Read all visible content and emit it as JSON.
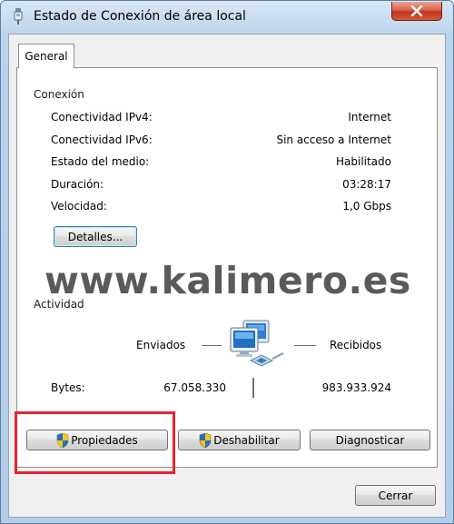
{
  "window": {
    "title": "Estado de Conexión de área local",
    "close_label": "✕"
  },
  "tabs": [
    {
      "label": "General"
    }
  ],
  "connection": {
    "group_title": "Conexión",
    "rows": [
      {
        "label": "Conectividad IPv4:",
        "value": "Internet"
      },
      {
        "label": "Conectividad IPv6:",
        "value": "Sin acceso a Internet"
      },
      {
        "label": "Estado del medio:",
        "value": "Habilitado"
      },
      {
        "label": "Duración:",
        "value": "03:28:17"
      },
      {
        "label": "Velocidad:",
        "value": "1,0 Gbps"
      }
    ],
    "details_button": "Detalles..."
  },
  "watermark": "www.kalimero.es",
  "activity": {
    "group_title": "Actividad",
    "sent_label": "Enviados",
    "received_label": "Recibidos",
    "bytes_label": "Bytes:",
    "bytes_sent": "67.058.330",
    "bytes_received": "983.933.924",
    "icon": "network-computers-icon"
  },
  "actions": {
    "properties": "Propiedades",
    "disable": "Deshabilitar",
    "diagnose": "Diagnosticar"
  },
  "footer": {
    "close_button": "Cerrar"
  },
  "colors": {
    "highlight_box": "#e8232e",
    "close_button_red": "#c0341c"
  }
}
